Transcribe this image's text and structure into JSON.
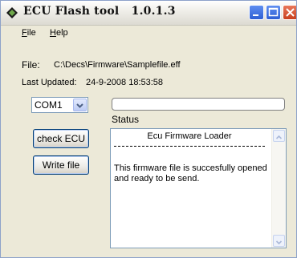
{
  "window": {
    "title": "ECU Flash tool   1.0.1.3"
  },
  "menu": {
    "file_label": "File",
    "file_mnemonic": "F",
    "file_rest": "ile",
    "help_label": "Help",
    "help_mnemonic": "H",
    "help_rest": "elp"
  },
  "file": {
    "label": "File:",
    "path": "C:\\Decs\\Firmware\\Samplefile.eff"
  },
  "last_updated": {
    "label": "Last Updated:",
    "value": "24-9-2008 18:53:58"
  },
  "port": {
    "selected": "COM1"
  },
  "status": {
    "label": "Status",
    "header": "Ecu Firmware Loader",
    "message": "This firmware file is succesfully opened and ready to be send."
  },
  "buttons": {
    "check_ecu": "check ECU",
    "write_file": "Write file"
  },
  "progress": {
    "value": 0
  },
  "icons": {
    "app": "ecu-chip-icon",
    "minimize": "minimize-icon",
    "maximize": "maximize-icon",
    "close": "close-icon"
  }
}
